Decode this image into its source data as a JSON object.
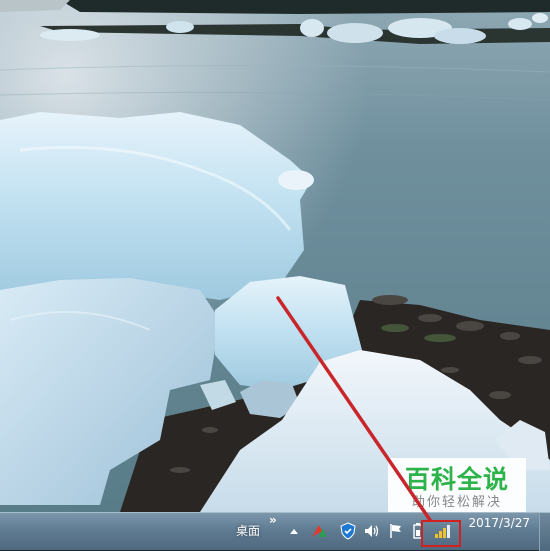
{
  "watermark": {
    "title": "百科全说",
    "subtitle": "助你轻松解决"
  },
  "taskbar": {
    "desktop_label": "桌面",
    "overflow_chevrons": "»",
    "clock": {
      "time": "",
      "date": "2017/3/27"
    },
    "tray_icons": [
      "show-hidden-icons-arrow",
      "antivirus-icon",
      "security-shield-icon",
      "volume-icon",
      "flag-icon",
      "battery-icon",
      "network-icon"
    ]
  },
  "annotation": {
    "highlight_color": "#d02020",
    "target": "network-icon"
  }
}
